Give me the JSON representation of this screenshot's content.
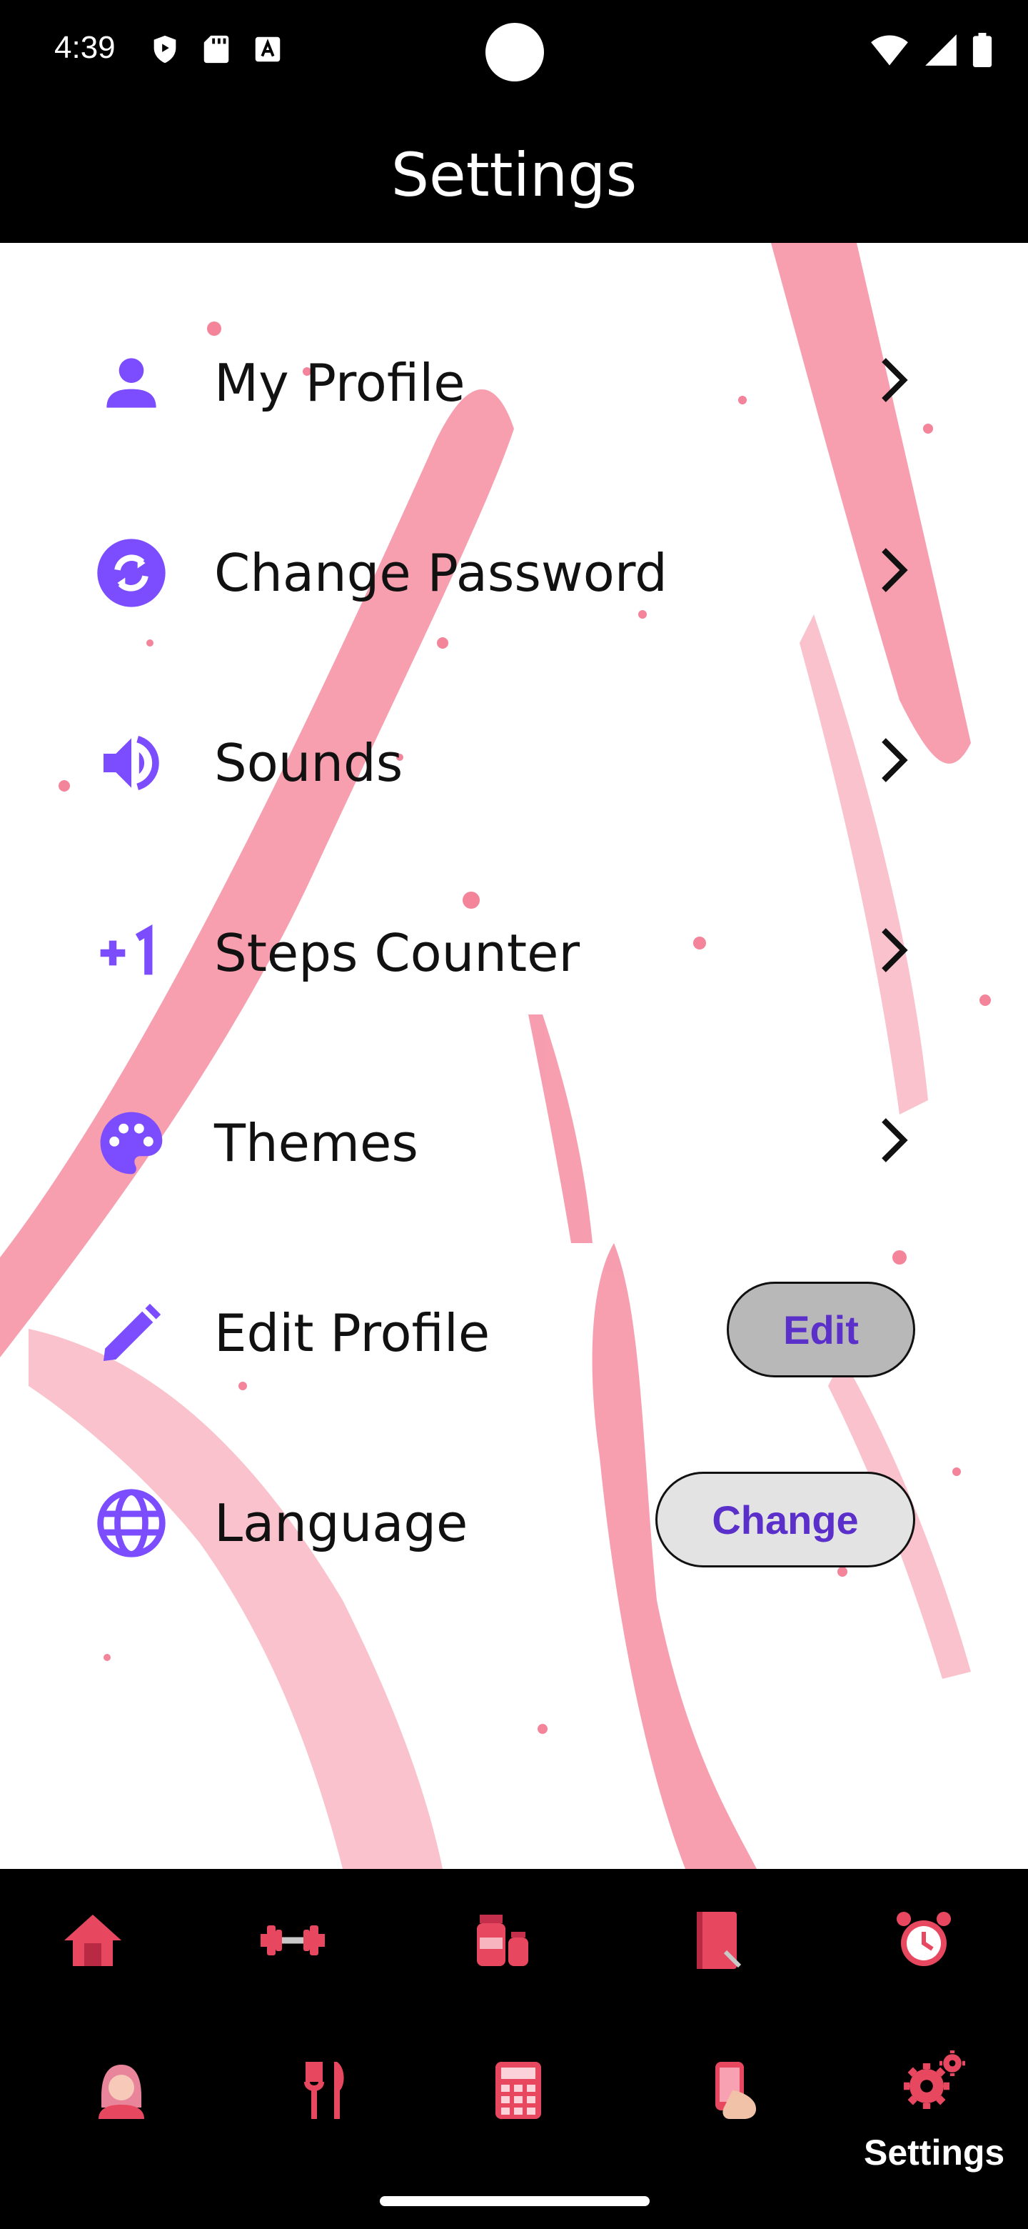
{
  "status_bar": {
    "time": "4:39",
    "left_icons": [
      "shield-icon",
      "sd-card-icon",
      "keyboard-a-icon"
    ],
    "right_icons": [
      "wifi-icon",
      "signal-icon",
      "battery-icon"
    ]
  },
  "header": {
    "title": "Settings"
  },
  "settings": {
    "items": [
      {
        "label": "My Profile",
        "icon": "person-icon",
        "action": "chevron"
      },
      {
        "label": "Change Password",
        "icon": "sync-icon",
        "action": "chevron"
      },
      {
        "label": "Sounds",
        "icon": "volume-icon",
        "action": "chevron"
      },
      {
        "label": "Steps Counter",
        "icon": "plus-one-icon",
        "action": "chevron"
      },
      {
        "label": "Themes",
        "icon": "palette-icon",
        "action": "chevron"
      },
      {
        "label": "Edit Profile",
        "icon": "pencil-icon",
        "action": "button",
        "button_label": "Edit"
      },
      {
        "label": "Language",
        "icon": "globe-icon",
        "action": "button",
        "button_label": "Change"
      }
    ]
  },
  "bottom_nav": {
    "row1": [
      "home-icon",
      "dumbbell-icon",
      "supplements-icon",
      "notebook-icon",
      "alarm-clock-icon"
    ],
    "row2": [
      "avatar-icon",
      "fork-knife-icon",
      "calculator-icon",
      "phone-hand-icon",
      "settings-gears-icon"
    ],
    "active_label": "Settings"
  },
  "colors": {
    "accent_purple": "#7b4dff",
    "button_text": "#5b2fc9",
    "pink": "#f0506e",
    "nav_pink": "#e8485f",
    "background": "#ffffff",
    "bars": "#000000"
  }
}
